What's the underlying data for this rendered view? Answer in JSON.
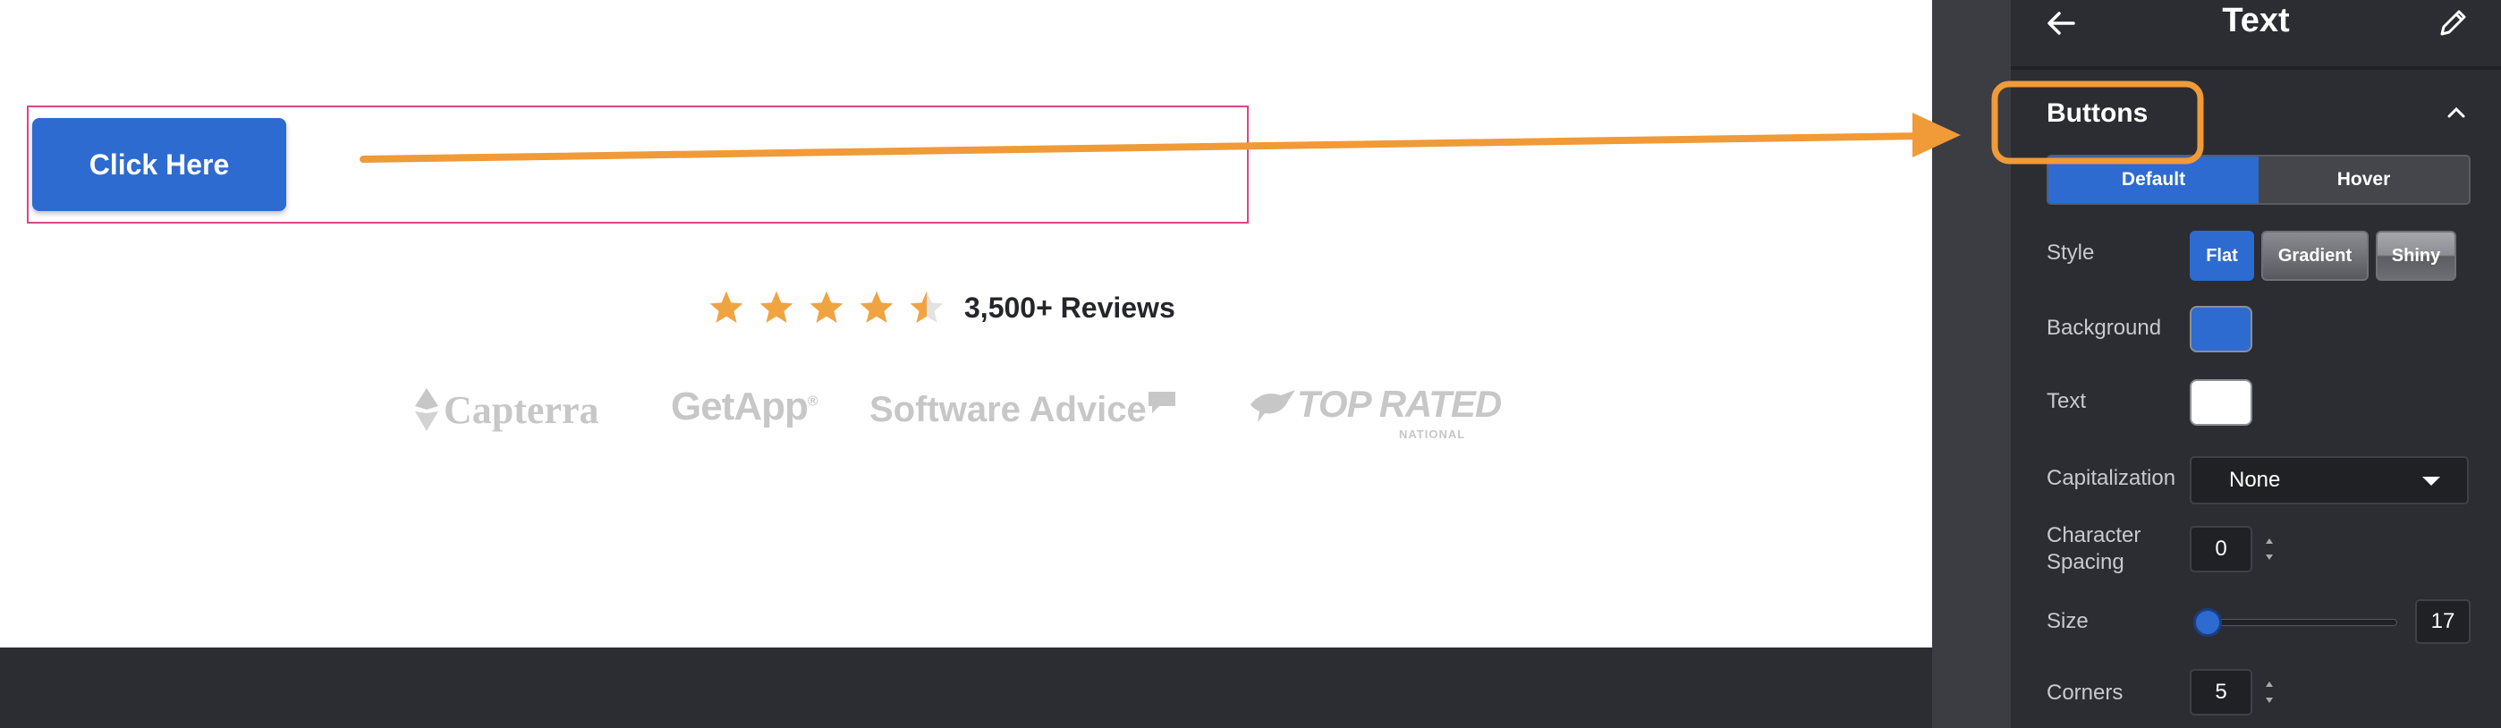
{
  "canvas": {
    "cta_label": "Click Here",
    "rating": {
      "value": 4.5,
      "max": 5,
      "reviews_text": "3,500+ Reviews",
      "star_color": "#f0a441"
    },
    "logos": {
      "capterra": "Capterra",
      "getapp": "GetApp",
      "getapp_mark": "®",
      "software_advice": "Software Advice",
      "top_rated": "TOP RATED",
      "top_rated_sub": "NATIONAL"
    }
  },
  "panel": {
    "title": "Text",
    "section": "Buttons",
    "state_tabs": [
      {
        "label": "Default",
        "active": true
      },
      {
        "label": "Hover",
        "active": false
      }
    ],
    "style": {
      "label": "Style",
      "options": [
        "Flat",
        "Gradient",
        "Shiny"
      ],
      "selected": "Flat"
    },
    "background": {
      "label": "Background",
      "color": "#2d6bd0"
    },
    "text_color": {
      "label": "Text",
      "color": "#ffffff"
    },
    "capitalization": {
      "label": "Capitalization",
      "value": "None"
    },
    "character_spacing": {
      "label": "Character Spacing",
      "value": "0"
    },
    "size": {
      "label": "Size",
      "value": "17",
      "fraction": 0.06
    },
    "corners": {
      "label": "Corners",
      "value": "5"
    }
  },
  "colors": {
    "accent_blue": "#2d6bd0",
    "annotation_orange": "#f09a38",
    "selection_pink": "#d9478a",
    "panel_bg": "#2b2d33"
  }
}
